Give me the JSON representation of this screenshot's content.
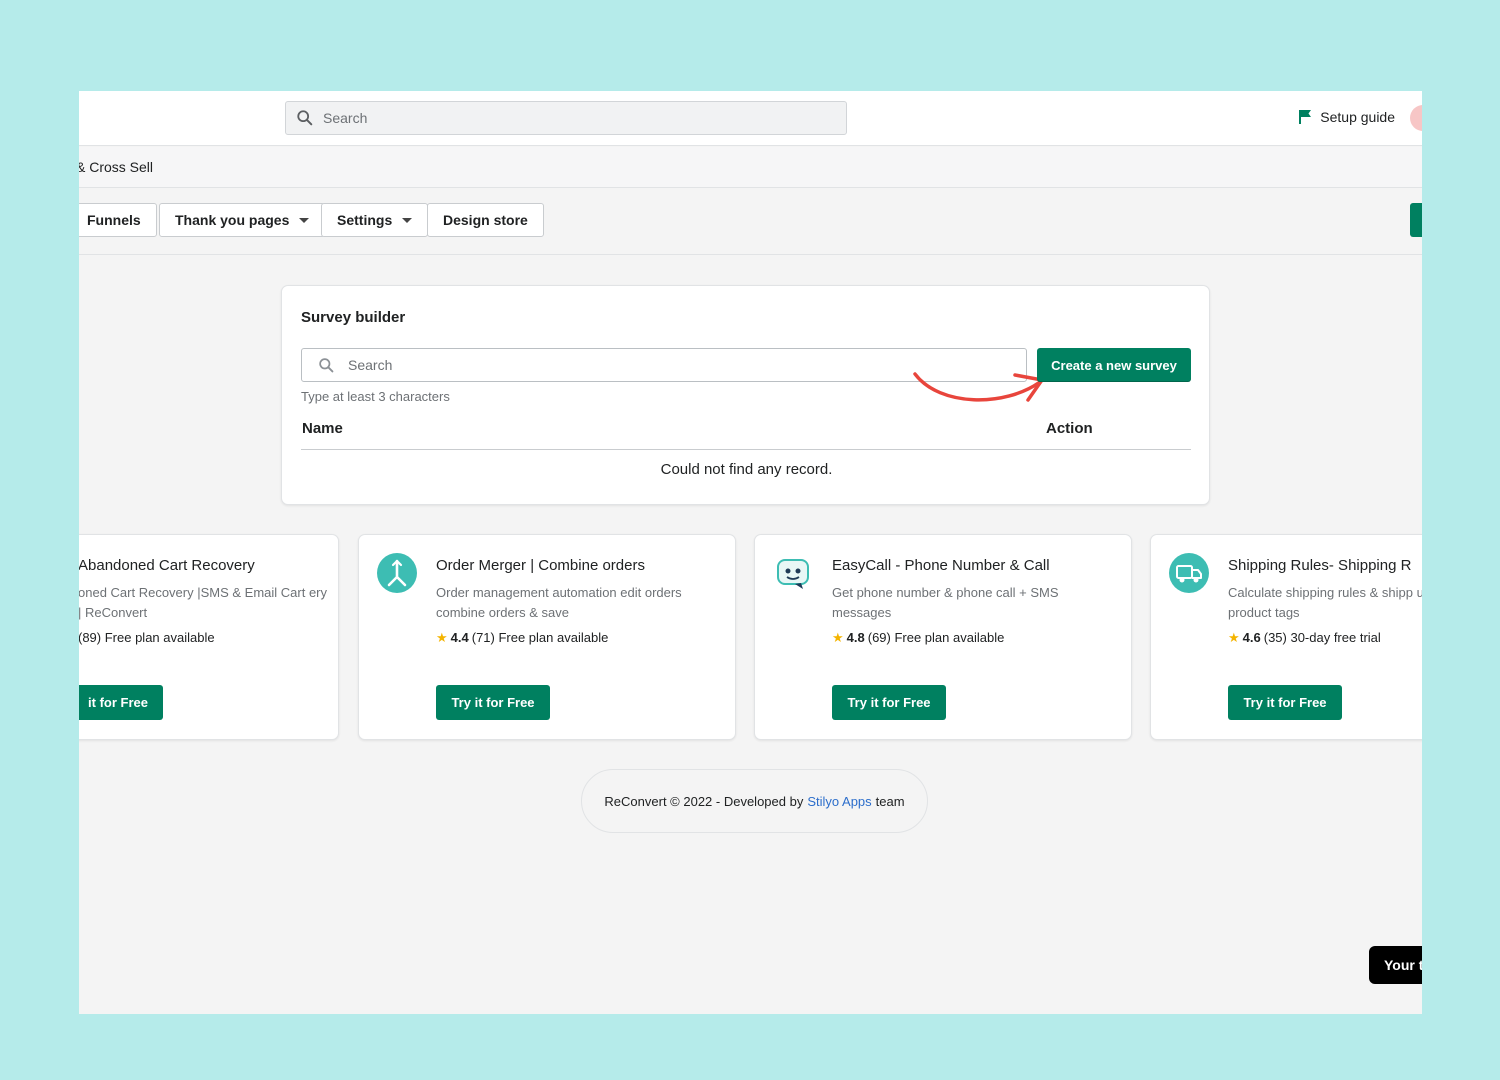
{
  "topbar": {
    "search_placeholder": "Search",
    "setup_guide": "Setup guide"
  },
  "breadcrumb": "& Cross Sell",
  "nav": {
    "funnels": "Funnels",
    "thank_you_pages": "Thank you pages",
    "settings": "Settings",
    "design_store": "Design store"
  },
  "survey": {
    "title": "Survey builder",
    "search_placeholder": "Search",
    "hint": "Type at least 3 characters",
    "create_button": "Create a new survey",
    "col_name": "Name",
    "col_action": "Action",
    "empty_text": "Could not find any record."
  },
  "apps": [
    {
      "name": "Abandoned Cart Recovery",
      "desc": "oned Cart Recovery |SMS & Email Cart ery | ReConvert",
      "rating": "",
      "reviews": "(89) Free plan available",
      "button": "it for Free"
    },
    {
      "name": "Order Merger | Combine orders",
      "desc": "Order management automation edit orders combine orders & save",
      "rating": "4.4",
      "reviews": "(71) Free plan available",
      "button": "Try it for Free"
    },
    {
      "name": "EasyCall - Phone Number & Call",
      "desc": "Get phone number & phone call + SMS messages",
      "rating": "4.8",
      "reviews": "(69) Free plan available",
      "button": "Try it for Free"
    },
    {
      "name": "Shipping Rules- Shipping R",
      "desc": "Calculate shipping rules & shipp using product tags",
      "rating": "4.6",
      "reviews": "(35) 30-day free trial",
      "button": "Try it for Free"
    }
  ],
  "footer": {
    "prefix": "ReConvert © 2022 - Developed by",
    "link": "Stilyo Apps",
    "suffix": "team"
  },
  "toast": "Your t",
  "colors": {
    "background": "#b5ebea",
    "primary_green": "#008060",
    "arrow_red": "#e8453c",
    "app_icon_teal": "#3dbdb3",
    "link_blue": "#2c6ecb"
  }
}
